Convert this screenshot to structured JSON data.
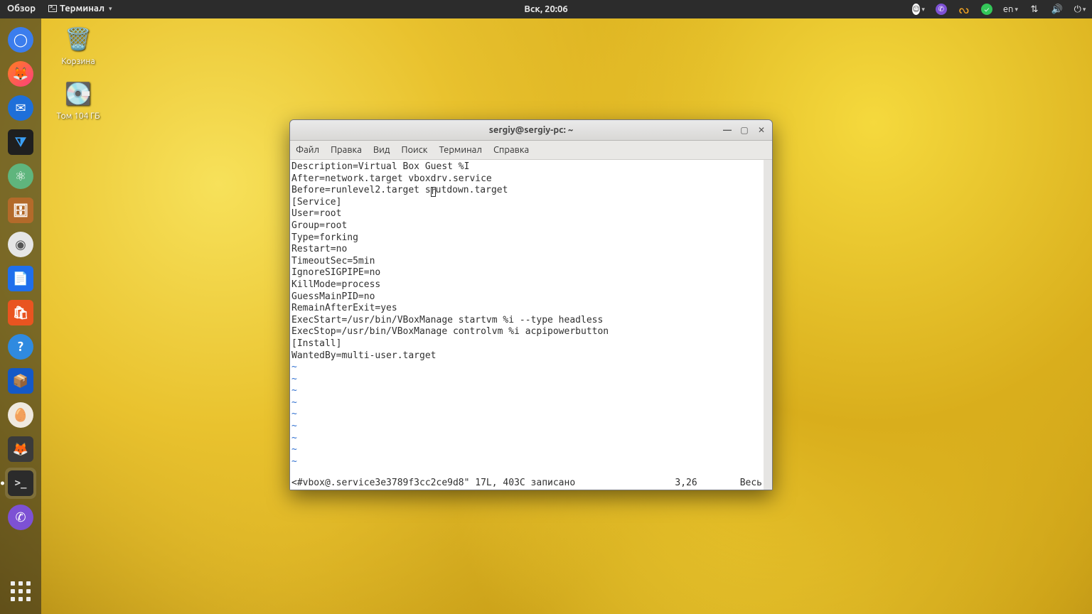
{
  "topbar": {
    "activities": "Обзор",
    "active_app": "Терминал",
    "clock": "Вск, 20:06",
    "lang": "en"
  },
  "desktop": {
    "trash_label": "Корзина",
    "volume_label": "Том 104 ГБ"
  },
  "terminal": {
    "title": "sergiy@sergiy-pc: ~",
    "menu": {
      "file": "Файл",
      "edit": "Правка",
      "view": "Вид",
      "search": "Поиск",
      "terminal": "Терминал",
      "help": "Справка"
    },
    "lines": [
      "Description=Virtual Box Guest %I",
      "After=network.target vboxdrv.service",
      "Before=runlevel2.target shutdown.target",
      "[Service]",
      "User=root",
      "Group=root",
      "Type=forking",
      "Restart=no",
      "TimeoutSec=5min",
      "IgnoreSIGPIPE=no",
      "KillMode=process",
      "GuessMainPID=no",
      "RemainAfterExit=yes",
      "ExecStart=/usr/bin/VBoxManage startvm %i --type headless",
      "ExecStop=/usr/bin/VBoxManage controlvm %i acpipowerbutton",
      "[Install]",
      "WantedBy=multi-user.target"
    ],
    "cursor": {
      "line_index": 2,
      "col": 26
    },
    "status": {
      "left": "<#vbox@.service3e3789f3cc2ce9d8\" 17L, 403C записано",
      "pos": "3,26",
      "right": "Весь"
    }
  }
}
